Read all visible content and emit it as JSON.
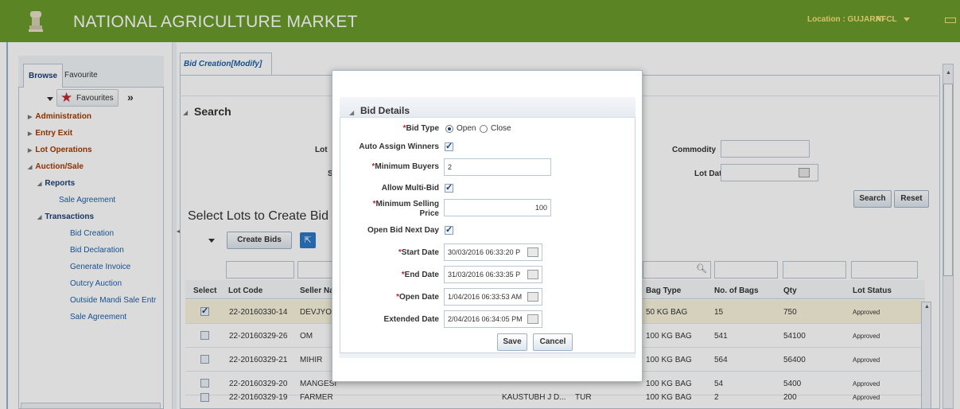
{
  "app": {
    "title": "NATIONAL AGRICULTURE MARKET",
    "location": "Location : GUJARAT",
    "user": "NFCL"
  },
  "sidebar": {
    "tabs": [
      "Browse",
      "Favourite"
    ],
    "favourites_label": "Favourites",
    "expand_symbol": "»",
    "tree": [
      {
        "label": "Administration"
      },
      {
        "label": "Entry Exit"
      },
      {
        "label": "Lot Operations"
      },
      {
        "label": "Auction/Sale"
      },
      {
        "label": "Reports"
      },
      {
        "label": "Sale Agreement"
      },
      {
        "label": "Transactions"
      },
      {
        "label": "Bid Creation"
      },
      {
        "label": "Bid Declaration"
      },
      {
        "label": "Generate Invoice"
      },
      {
        "label": "Outcry Auction"
      },
      {
        "label": "Outside Mandi Sale Entr"
      },
      {
        "label": "Sale Agreement"
      }
    ]
  },
  "main": {
    "tab_label": "Bid Creation[Modify]",
    "search": {
      "header": "Search",
      "lot_label": "Lot",
      "s_label": "S",
      "commodity_label": "Commodity",
      "lot_date_label": "Lot Date",
      "search_button": "Search",
      "reset_button": "Reset"
    },
    "section_title": "Select Lots to Create Bid",
    "create_bids_button": "Create Bids",
    "columns": [
      "Select",
      "Lot Code",
      "Seller Na",
      "Bag Type",
      "No. of Bags",
      "Qty",
      "Lot Status"
    ],
    "rows": [
      {
        "checked": true,
        "lot_code": "22-20160330-14",
        "seller": "DEVJYOT",
        "extra1": "",
        "extra2": "",
        "bag_type": "50 KG BAG",
        "bags": "15",
        "qty": "750",
        "status": "Approved"
      },
      {
        "checked": false,
        "lot_code": "22-20160329-26",
        "seller": "OM",
        "extra1": "",
        "extra2": "",
        "bag_type": "100 KG BAG",
        "bags": "541",
        "qty": "54100",
        "status": "Approved"
      },
      {
        "checked": false,
        "lot_code": "22-20160329-21",
        "seller": "MIHIR",
        "extra1": "",
        "extra2": "",
        "bag_type": "100 KG BAG",
        "bags": "564",
        "qty": "56400",
        "status": "Approved"
      },
      {
        "checked": false,
        "lot_code": "22-20160329-20",
        "seller": "MANGESI",
        "extra1": "",
        "extra2": "",
        "bag_type": "100 KG BAG",
        "bags": "54",
        "qty": "5400",
        "status": "Approved"
      },
      {
        "checked": false,
        "lot_code": "22-20160329-19",
        "seller": "FARMER",
        "extra1": "KAUSTUBH J D...",
        "extra2": "TUR",
        "bag_type": "100 KG BAG",
        "bags": "2",
        "qty": "200",
        "status": "Approved"
      }
    ]
  },
  "dialog": {
    "title": "Bid Details",
    "bid_type_label": "Bid Type",
    "bid_type_options": [
      "Open",
      "Close"
    ],
    "bid_type_selected": "Open",
    "auto_assign_label": "Auto Assign Winners",
    "auto_assign_checked": true,
    "min_buyers_label": "Minimum Buyers",
    "min_buyers_value": "2",
    "allow_multi_label": "Allow Multi-Bid",
    "allow_multi_checked": true,
    "min_price_label_1": "Minimum Selling",
    "min_price_label_2": "Price",
    "min_price_value": "100",
    "open_next_label": "Open Bid Next Day",
    "open_next_checked": true,
    "start_date_label": "Start Date",
    "start_date_value": "30/03/2016 06:33:20 P",
    "end_date_label": "End Date",
    "end_date_value": "31/03/2016 06:33:35 P",
    "open_date_label": "Open Date",
    "open_date_value": "1/04/2016 06:33:53 AM",
    "extended_date_label": "Extended Date",
    "extended_date_value": "2/04/2016 06:34:05 PM",
    "save_button": "Save",
    "cancel_button": "Cancel"
  },
  "colors": {
    "topbar": "#6a9a2a",
    "accent": "#1b3f73",
    "header_text": "#f5e27a",
    "required": "#c1272d"
  }
}
